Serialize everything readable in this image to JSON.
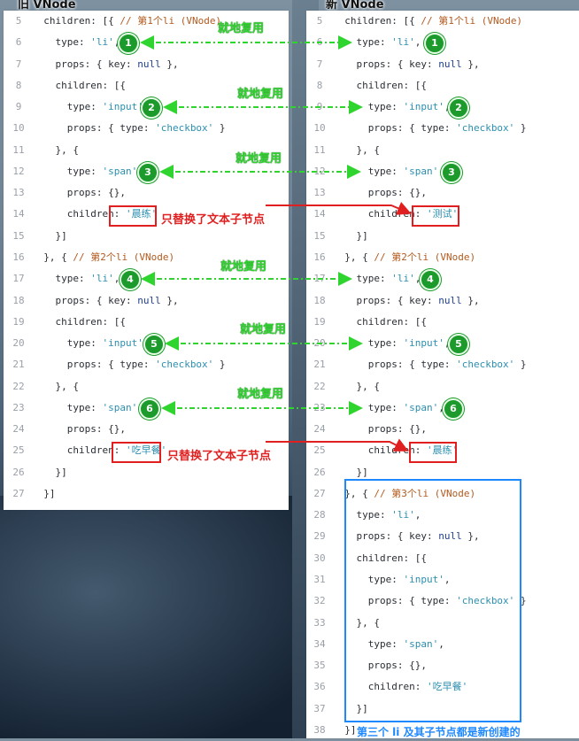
{
  "old_panel": {
    "title": "旧 VNode",
    "lines": [
      {
        "n": "5",
        "t": "  children: [{ // 第1个li (VNode)"
      },
      {
        "n": "6",
        "t": "    type: 'li',"
      },
      {
        "n": "7",
        "t": "    props: { key: null },"
      },
      {
        "n": "8",
        "t": "    children: [{"
      },
      {
        "n": "9",
        "t": "      type: 'input',"
      },
      {
        "n": "10",
        "t": "      props: { type: 'checkbox' }"
      },
      {
        "n": "11",
        "t": "    }, {"
      },
      {
        "n": "12",
        "t": "      type: 'span',"
      },
      {
        "n": "13",
        "t": "      props: {},"
      },
      {
        "n": "14",
        "t": "      children: '晨练'"
      },
      {
        "n": "15",
        "t": "    }]"
      },
      {
        "n": "16",
        "t": "  }, { // 第2个li (VNode)"
      },
      {
        "n": "17",
        "t": "    type: 'li',"
      },
      {
        "n": "18",
        "t": "    props: { key: null },"
      },
      {
        "n": "19",
        "t": "    children: [{"
      },
      {
        "n": "20",
        "t": "      type: 'input',"
      },
      {
        "n": "21",
        "t": "      props: { type: 'checkbox' }"
      },
      {
        "n": "22",
        "t": "    }, {"
      },
      {
        "n": "23",
        "t": "      type: 'span',"
      },
      {
        "n": "24",
        "t": "      props: {},"
      },
      {
        "n": "25",
        "t": "      children: '吃早餐'"
      },
      {
        "n": "26",
        "t": "    }]"
      },
      {
        "n": "27",
        "t": "  }]"
      }
    ]
  },
  "new_panel": {
    "title": "新 VNode",
    "lines": [
      {
        "n": "5",
        "t": "  children: [{ // 第1个li (VNode)"
      },
      {
        "n": "6",
        "t": "    type: 'li',"
      },
      {
        "n": "7",
        "t": "    props: { key: null },"
      },
      {
        "n": "8",
        "t": "    children: [{"
      },
      {
        "n": "9",
        "t": "      type: 'input',"
      },
      {
        "n": "10",
        "t": "      props: { type: 'checkbox' }"
      },
      {
        "n": "11",
        "t": "    }, {"
      },
      {
        "n": "12",
        "t": "      type: 'span',"
      },
      {
        "n": "13",
        "t": "      props: {},"
      },
      {
        "n": "14",
        "t": "      children: '测试'"
      },
      {
        "n": "15",
        "t": "    }]"
      },
      {
        "n": "16",
        "t": "  }, { // 第2个li (VNode)"
      },
      {
        "n": "17",
        "t": "    type: 'li',"
      },
      {
        "n": "18",
        "t": "    props: { key: null },"
      },
      {
        "n": "19",
        "t": "    children: [{"
      },
      {
        "n": "20",
        "t": "      type: 'input',"
      },
      {
        "n": "21",
        "t": "      props: { type: 'checkbox' }"
      },
      {
        "n": "22",
        "t": "    }, {"
      },
      {
        "n": "23",
        "t": "      type: 'span',"
      },
      {
        "n": "24",
        "t": "      props: {},"
      },
      {
        "n": "25",
        "t": "      children: '晨练'"
      },
      {
        "n": "26",
        "t": "    }]"
      },
      {
        "n": "27",
        "t": "  }, { // 第3个li (VNode)"
      },
      {
        "n": "28",
        "t": "    type: 'li',"
      },
      {
        "n": "29",
        "t": "    props: { key: null },"
      },
      {
        "n": "30",
        "t": "    children: [{"
      },
      {
        "n": "31",
        "t": "      type: 'input',"
      },
      {
        "n": "32",
        "t": "      props: { type: 'checkbox' }"
      },
      {
        "n": "33",
        "t": "    }, {"
      },
      {
        "n": "34",
        "t": "      type: 'span',"
      },
      {
        "n": "35",
        "t": "      props: {},"
      },
      {
        "n": "36",
        "t": "      children: '吃早餐'"
      },
      {
        "n": "37",
        "t": "    }]"
      },
      {
        "n": "38",
        "t": "  }]"
      }
    ]
  },
  "annotations": {
    "reuse": "就地复用",
    "replace_text": "只替换了文本子节点",
    "new_created": "第三个 li 及其子节点都是新创建的",
    "badges": [
      "1",
      "2",
      "3",
      "4",
      "5",
      "6"
    ]
  },
  "colors": {
    "green": "#1d9a2c",
    "red": "#e02020",
    "blue": "#1e88ff"
  }
}
